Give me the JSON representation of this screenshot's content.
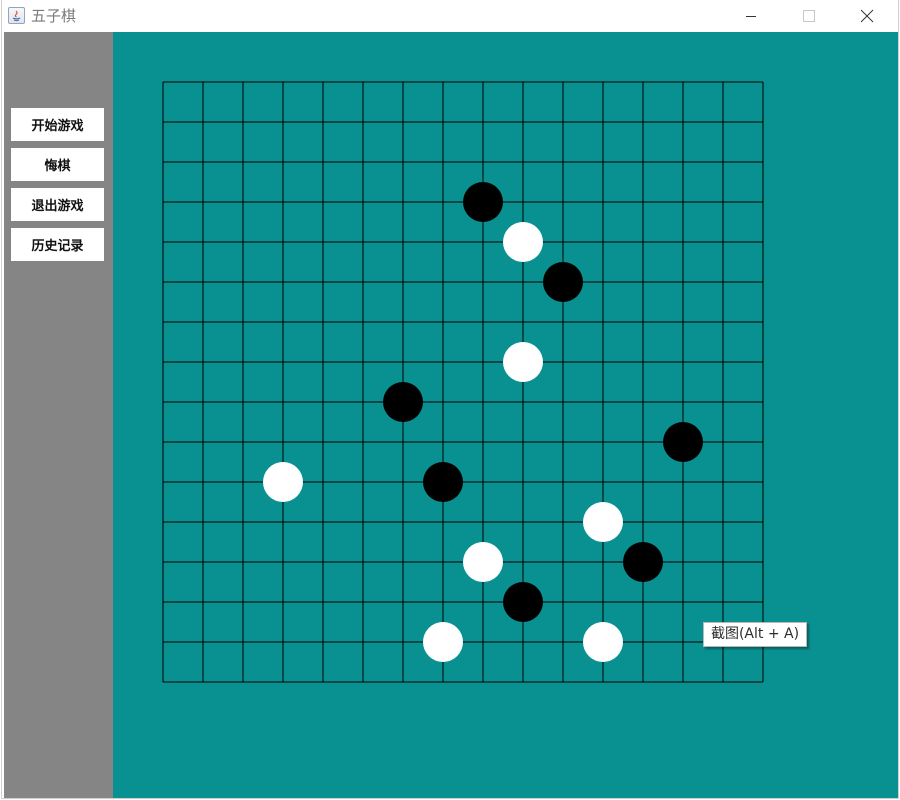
{
  "window": {
    "title": "五子棋",
    "title_color": "#7a7a7a"
  },
  "titlebar_controls": [
    {
      "name": "minimize-icon",
      "glyph": "—"
    },
    {
      "name": "maximize-icon",
      "glyph": "☐"
    },
    {
      "name": "close-icon",
      "glyph": "✕"
    }
  ],
  "sidebar": {
    "background": "#858585",
    "buttons": [
      {
        "id": "start-game-button",
        "label": "开始游戏"
      },
      {
        "id": "undo-move-button",
        "label": "悔棋"
      },
      {
        "id": "exit-game-button",
        "label": "退出游戏"
      },
      {
        "id": "history-button",
        "label": "历史记录"
      }
    ]
  },
  "board": {
    "background": "#099090",
    "line_color": "#000000",
    "lines": 16,
    "stone_colors": {
      "black": "#000000",
      "white": "#ffffff"
    },
    "stones": [
      {
        "col": 8,
        "row": 3,
        "color": "black"
      },
      {
        "col": 9,
        "row": 4,
        "color": "white"
      },
      {
        "col": 10,
        "row": 5,
        "color": "black"
      },
      {
        "col": 9,
        "row": 7,
        "color": "white"
      },
      {
        "col": 6,
        "row": 8,
        "color": "black"
      },
      {
        "col": 13,
        "row": 9,
        "color": "black"
      },
      {
        "col": 3,
        "row": 10,
        "color": "white"
      },
      {
        "col": 7,
        "row": 10,
        "color": "black"
      },
      {
        "col": 11,
        "row": 11,
        "color": "white"
      },
      {
        "col": 8,
        "row": 12,
        "color": "white"
      },
      {
        "col": 12,
        "row": 12,
        "color": "black"
      },
      {
        "col": 9,
        "row": 13,
        "color": "black"
      },
      {
        "col": 7,
        "row": 14,
        "color": "white"
      },
      {
        "col": 11,
        "row": 14,
        "color": "white"
      }
    ]
  },
  "tooltip": {
    "text": "截图(Alt + A)"
  }
}
